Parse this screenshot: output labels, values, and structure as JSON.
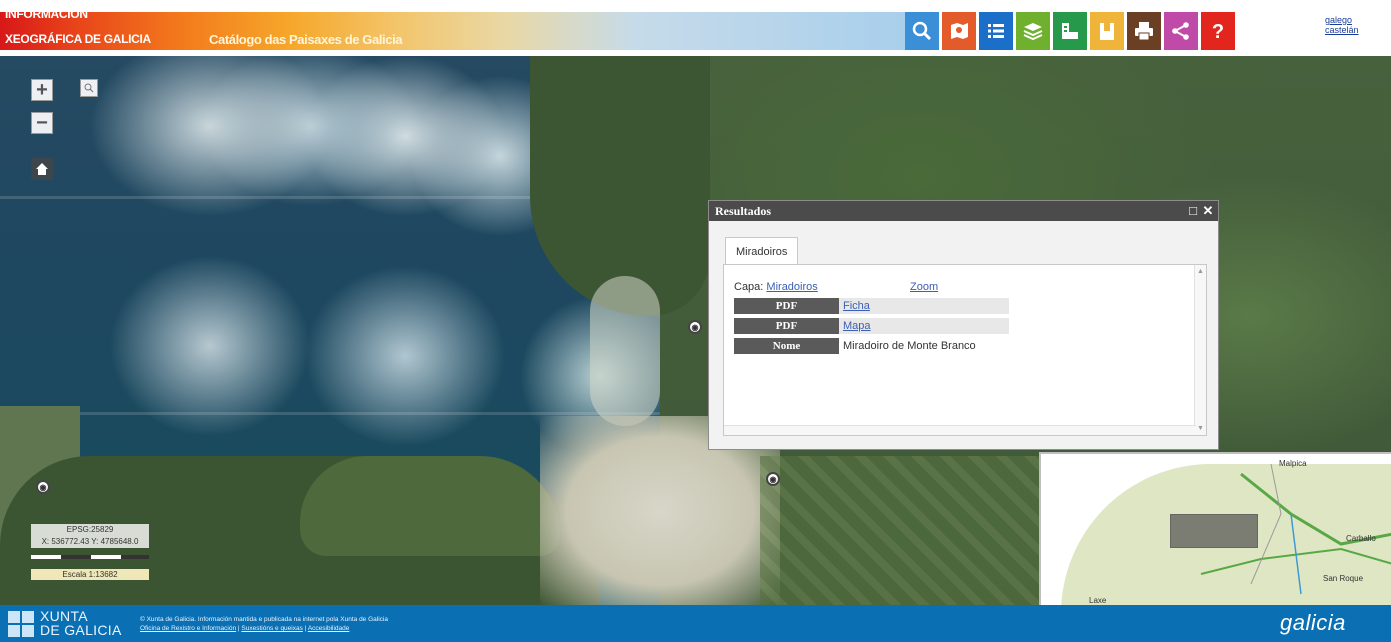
{
  "header": {
    "brand_line1": "INFORMACIÓN",
    "brand_line2": "XEOGRÁFICA DE GALICIA",
    "app_title": "Catálogo das Paisaxes de Galicia",
    "language_link": "galego castelán",
    "toolbar": [
      {
        "name": "search",
        "color": "#3a8fd6"
      },
      {
        "name": "map-info",
        "color": "#e35a2b"
      },
      {
        "name": "list",
        "color": "#1c6fc9"
      },
      {
        "name": "layers",
        "color": "#6fb02f"
      },
      {
        "name": "measure",
        "color": "#269a4a"
      },
      {
        "name": "bookmark",
        "color": "#efb43a"
      },
      {
        "name": "print",
        "color": "#6b3f24"
      },
      {
        "name": "share",
        "color": "#c04aa8"
      },
      {
        "name": "help",
        "color": "#e2261e"
      }
    ]
  },
  "map": {
    "zoom_in": "+",
    "zoom_out": "−",
    "scale": {
      "epsg": "EPSG:25829",
      "coords": "X: 536772.43 Y: 4785648.0",
      "label": "Escala 1:13682"
    }
  },
  "popup": {
    "title": "Resultados",
    "tab": "Miradoiros",
    "capa_label": "Capa:",
    "capa_value": "Miradoiros",
    "zoom_link": "Zoom",
    "rows": [
      {
        "header": "PDF",
        "value": "Ficha"
      },
      {
        "header": "PDF",
        "value": "Mapa"
      },
      {
        "header": "Nome",
        "value": "Miradoiro de Monte Branco"
      }
    ]
  },
  "overview": {
    "labels": [
      "Malpica",
      "Carballo",
      "San Roque",
      "Laxe"
    ]
  },
  "footer": {
    "xunta_line1": "XUNTA",
    "xunta_line2": "DE GALICIA",
    "legal_line1": "© Xunta de Galicia. Información mantida e publicada na internet pola Xunta de Galicia",
    "legal_line2a": "Oficina de Rexistro e Información",
    "legal_line2b": "Suxestións e queixas",
    "legal_line2c": "Accesibilidade",
    "galicia_logo": "galicia"
  }
}
